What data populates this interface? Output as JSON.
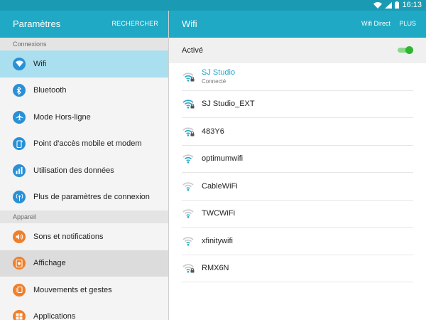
{
  "statusbar": {
    "time": "16:13"
  },
  "app": {
    "title": "Paramètres",
    "search_label": "RECHERCHER"
  },
  "sidebar": {
    "sections": [
      {
        "header": "Connexions",
        "items": [
          {
            "label": "Wifi",
            "icon": "wifi-icon",
            "state": "active"
          },
          {
            "label": "Bluetooth",
            "icon": "bluetooth-icon"
          },
          {
            "label": "Mode Hors-ligne",
            "icon": "airplane-icon"
          },
          {
            "label": "Point d'accès mobile et modem",
            "icon": "hotspot-icon"
          },
          {
            "label": "Utilisation des données",
            "icon": "data-usage-icon"
          },
          {
            "label": "Plus de paramètres de connexion",
            "icon": "more-connections-icon"
          }
        ]
      },
      {
        "header": "Appareil",
        "items": [
          {
            "label": "Sons et notifications",
            "icon": "sound-icon"
          },
          {
            "label": "Affichage",
            "icon": "display-icon",
            "state": "highlight"
          },
          {
            "label": "Mouvements et gestes",
            "icon": "motion-icon"
          },
          {
            "label": "Applications",
            "icon": "apps-icon"
          }
        ]
      }
    ]
  },
  "wifi": {
    "title": "Wifi",
    "wifi_direct_label": "Wifi Direct",
    "more_label": "PLUS",
    "active_label": "Activé",
    "toggle_on": true,
    "networks": [
      {
        "name": "SJ Studio",
        "status": "Connecté",
        "connected": true,
        "secured": true,
        "strength": 3
      },
      {
        "name": "SJ Studio_EXT",
        "secured": true,
        "strength": 4
      },
      {
        "name": "483Y6",
        "secured": true,
        "strength": 3
      },
      {
        "name": "optimumwifi",
        "secured": false,
        "strength": 3
      },
      {
        "name": "CableWiFi",
        "secured": false,
        "strength": 2
      },
      {
        "name": "TWCWiFi",
        "secured": false,
        "strength": 2
      },
      {
        "name": "xfinitywifi",
        "secured": false,
        "strength": 2
      },
      {
        "name": "RMX6N",
        "secured": true,
        "strength": 2
      }
    ]
  },
  "colors": {
    "accent": "#1fa9c4",
    "connected_text": "#27a7c7"
  }
}
